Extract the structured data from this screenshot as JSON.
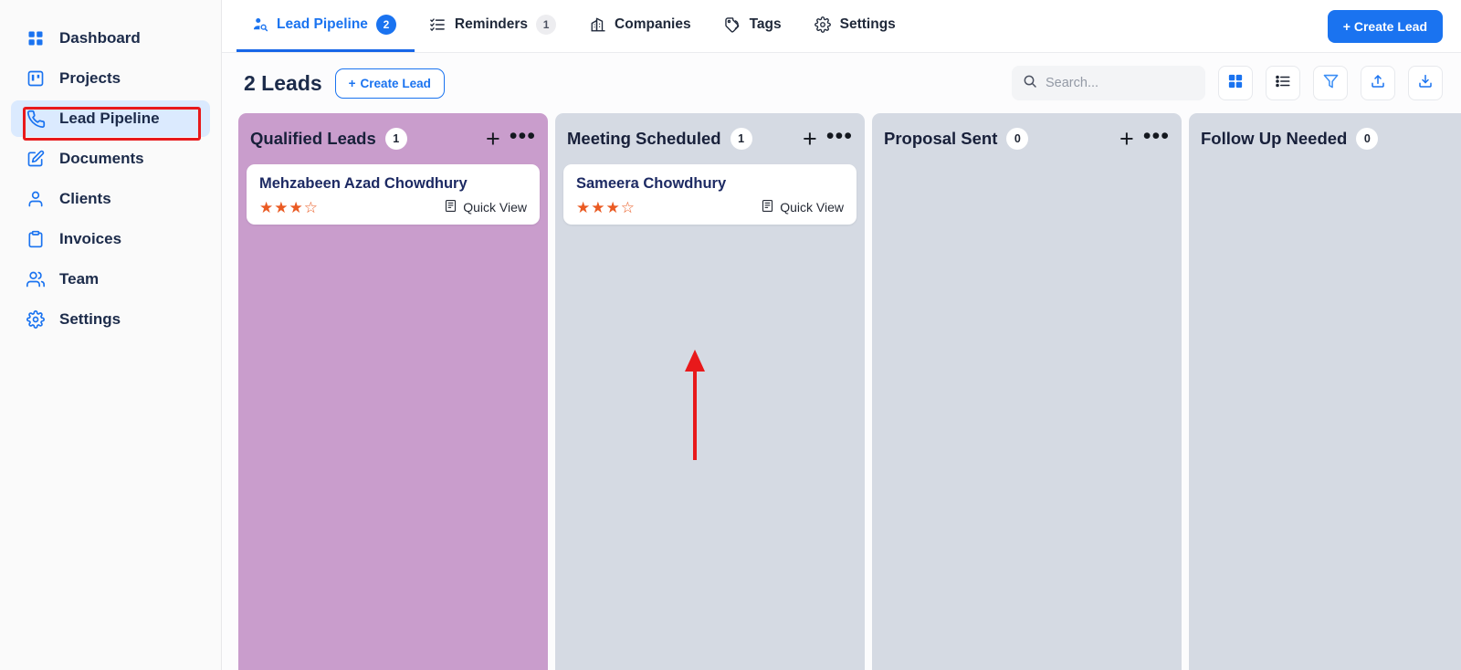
{
  "sidebar": {
    "items": [
      {
        "label": "Dashboard",
        "icon": "grid-icon",
        "active": false
      },
      {
        "label": "Projects",
        "icon": "board-icon",
        "active": false
      },
      {
        "label": "Lead Pipeline",
        "icon": "phone-icon",
        "active": true
      },
      {
        "label": "Documents",
        "icon": "edit-doc-icon",
        "active": false
      },
      {
        "label": "Clients",
        "icon": "user-icon",
        "active": false
      },
      {
        "label": "Invoices",
        "icon": "clipboard-icon",
        "active": false
      },
      {
        "label": "Team",
        "icon": "users-icon",
        "active": false
      },
      {
        "label": "Settings",
        "icon": "gear-icon",
        "active": false
      }
    ]
  },
  "tabs": [
    {
      "label": "Lead Pipeline",
      "badge": "2",
      "icon": "user-search-icon",
      "active": true
    },
    {
      "label": "Reminders",
      "badge": "1",
      "icon": "checklist-icon",
      "active": false
    },
    {
      "label": "Companies",
      "badge": "",
      "icon": "building-icon",
      "active": false
    },
    {
      "label": "Tags",
      "badge": "",
      "icon": "tag-icon",
      "active": false
    },
    {
      "label": "Settings",
      "badge": "",
      "icon": "gear-icon",
      "active": false
    }
  ],
  "header": {
    "create_lead_top_label": "+ Create Lead"
  },
  "toolbar": {
    "leads_count_label": "2 Leads",
    "create_lead_label": "Create Lead",
    "create_lead_plus": "+",
    "search_placeholder": "Search...",
    "search_value": "",
    "buttons": [
      {
        "name": "grid-view-button",
        "icon": "grid-view-icon",
        "active": true
      },
      {
        "name": "list-view-button",
        "icon": "list-view-icon",
        "active": false
      },
      {
        "name": "filter-button",
        "icon": "filter-icon",
        "active": false
      },
      {
        "name": "export-button",
        "icon": "upload-icon",
        "active": false
      },
      {
        "name": "import-button",
        "icon": "download-icon",
        "active": false
      }
    ]
  },
  "board": {
    "add_symbol": "+",
    "more_symbol": "•••",
    "quick_view_label": "Quick View",
    "columns": [
      {
        "title": "Qualified Leads",
        "count": "1",
        "color": "#c99dcc",
        "cards": [
          {
            "name": "Mehzabeen Azad Chowdhury",
            "rating": 3,
            "rating_max": 4
          }
        ]
      },
      {
        "title": "Meeting Scheduled",
        "count": "1",
        "color": "#d5dae3",
        "cards": [
          {
            "name": "Sameera Chowdhury",
            "rating": 3,
            "rating_max": 4
          }
        ]
      },
      {
        "title": "Proposal Sent",
        "count": "0",
        "color": "#d5dae3",
        "cards": []
      },
      {
        "title": "Follow Up Needed",
        "count": "0",
        "color": "#d5dae3",
        "cards": []
      }
    ]
  },
  "annotations": {
    "highlight_color": "#e8191b",
    "highlighted_sidebar_item": "Lead Pipeline",
    "arrow_target": "Quick View"
  },
  "colors": {
    "accent_blue": "#1a73f0",
    "star_orange": "#ea5a22",
    "column_purple": "#c99dcc",
    "column_gray": "#d5dae3"
  }
}
